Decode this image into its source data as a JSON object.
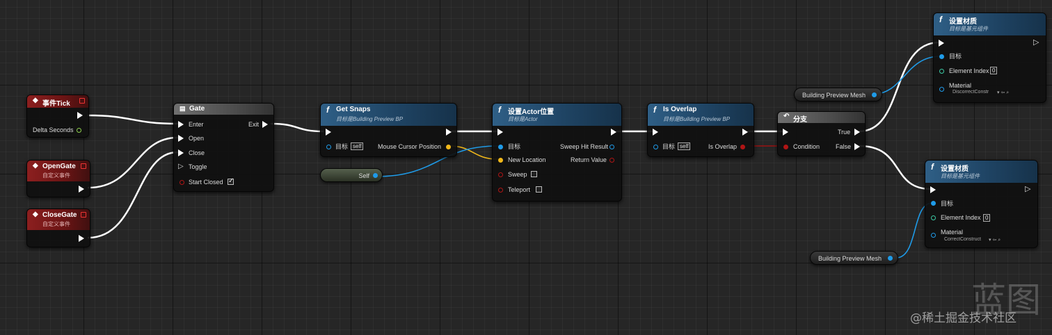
{
  "nodes": {
    "event_tick": {
      "title": "事件Tick",
      "pin_delta": "Delta Seconds"
    },
    "open_gate": {
      "title": "OpenGate",
      "subtitle": "自定义事件"
    },
    "close_gate": {
      "title": "CloseGate",
      "subtitle": "自定义事件"
    },
    "gate": {
      "title": "Gate",
      "pins": {
        "enter": "Enter",
        "open": "Open",
        "close": "Close",
        "toggle": "Toggle",
        "start_closed": "Start Closed",
        "exit": "Exit"
      },
      "start_closed_checked": true
    },
    "get_snaps": {
      "title": "Get Snaps",
      "subtitle": "目标是Building Preview BP",
      "pin_target": "目标",
      "target_value": "self",
      "pin_mouse": "Mouse Cursor Position"
    },
    "self_node": {
      "label": "Self"
    },
    "set_actor_location": {
      "title": "设置Actor位置",
      "subtitle": "目标是Actor",
      "pins": {
        "target": "目标",
        "new_location": "New Location",
        "sweep": "Sweep",
        "teleport": "Teleport",
        "sweep_hit": "Sweep Hit Result",
        "return_value": "Return Value"
      }
    },
    "is_overlap": {
      "title": "Is Overlap",
      "subtitle": "目标是Building Preview BP",
      "pin_target": "目标",
      "target_value": "self",
      "pin_out": "Is Overlap"
    },
    "branch": {
      "title": "分支",
      "pin_condition": "Condition",
      "pin_true": "True",
      "pin_false": "False"
    },
    "set_material_top": {
      "title": "设置材质",
      "subtitle": "目标是基元组件",
      "pin_target": "目标",
      "pin_index": "Element Index",
      "index_value": "0",
      "pin_material": "Material",
      "material_value": "DiscorrectConstr"
    },
    "set_material_bottom": {
      "title": "设置材质",
      "subtitle": "目标是基元组件",
      "pin_target": "目标",
      "pin_index": "Element Index",
      "index_value": "0",
      "pin_material": "Material",
      "material_value": "CorrectConstruct"
    },
    "mesh_top": {
      "label": "Building Preview Mesh"
    },
    "mesh_bottom": {
      "label": "Building Preview Mesh"
    }
  },
  "icons": {
    "event": "diamond-icon",
    "function": "function-f-icon",
    "gate": "gate-icon",
    "branch": "branch-arrow-icon"
  },
  "colors": {
    "exec_wire": "#ffffff",
    "object_wire": "#1f9be8",
    "vector_wire": "#f1b81a",
    "bool_wire": "#9b1010",
    "function_header": "#2f5f86",
    "event_header": "#8c1f1f"
  },
  "watermark": {
    "big": "蓝图",
    "text": "@稀土掘金技术社区"
  }
}
